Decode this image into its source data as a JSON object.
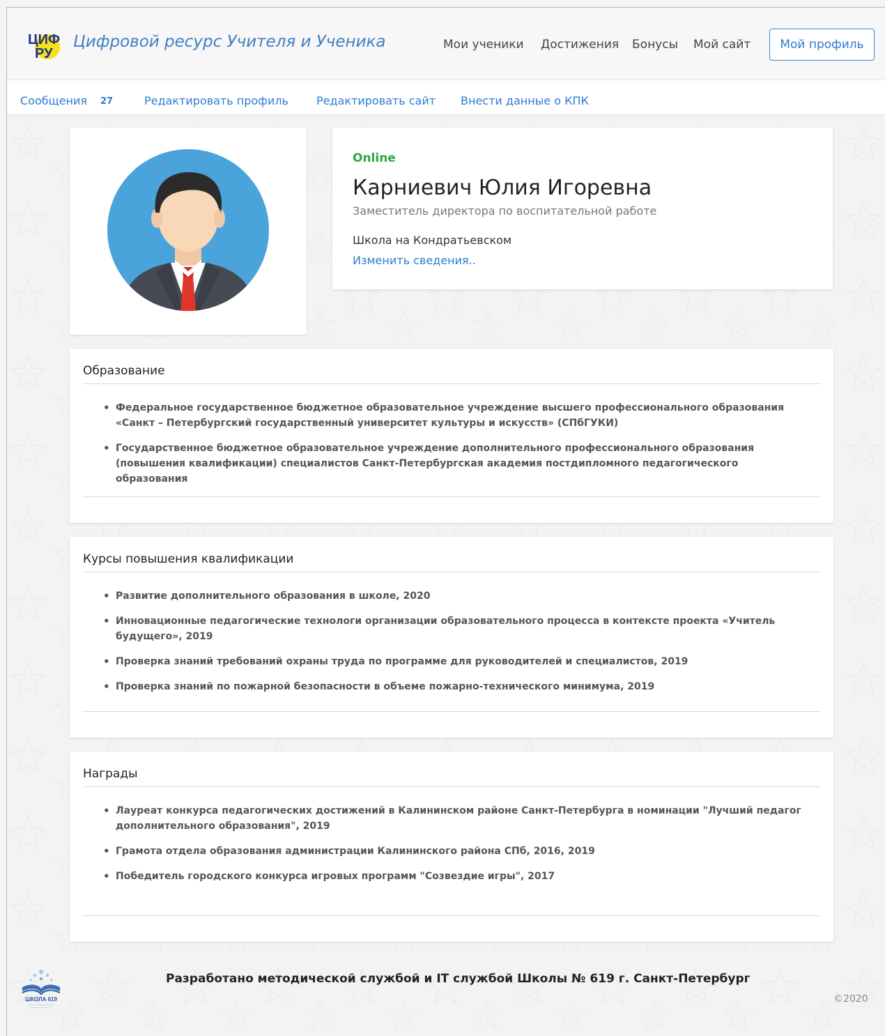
{
  "header": {
    "brand_logo_text": "ЦИФ РУ",
    "brand_name": "Цифровой ресурс Учителя и Ученика",
    "nav": [
      "Мои ученики",
      "Достижения",
      "Бонусы",
      "Мой сайт"
    ],
    "profile_button": "Мой профиль"
  },
  "subnav": {
    "messages_label": "Сообщения",
    "messages_count": "27",
    "edit_profile": "Редактировать профиль",
    "edit_site": "Редактировать сайт",
    "add_kpk": "Внести данные о КПК"
  },
  "profile": {
    "status": "Online",
    "name": "Карниевич Юлия Игоревна",
    "position": "Заместитель директора по воспитательной работе",
    "school": "Школа на Кондратьевском",
    "edit_link": "Изменить сведения.."
  },
  "education": {
    "title": "Образование",
    "items": [
      "Федеральное государственное бюджетное образовательное учреждение высшего профессионального образования «Санкт – Петербургский государственный университет культуры и искусств» (СПбГУКИ)",
      "Государственное бюджетное образовательное учреждение дополнительного профессионального образования (повышения квалификации) специалистов Санкт-Петербургская академия постдипломного педагогического образования"
    ]
  },
  "courses": {
    "title": "Курсы повышения квалификации",
    "items": [
      "Развитие дополнительного образования в школе, 2020",
      "Инновационные педагогические технологи организации образовательного процесса в контексте проекта «Учитель будущего», 2019",
      "Проверка знаний требований охраны труда по программе для руководителей и специалистов, 2019",
      "Проверка знаний по пожарной безопасности в объеме пожарно-технического минимума, 2019"
    ]
  },
  "awards": {
    "title": "Награды",
    "items": [
      "Лауреат конкурса педагогических достижений в Калининском районе Санкт-Петербурга в номинации \"Лучший педагог дополнительного образования\", 2019",
      "Грамота отдела образования администрации Калининского района СПб, 2016, 2019",
      "Победитель городского конкурса игровых программ \"Созвездие игры\", 2017"
    ]
  },
  "footer": {
    "logo_caption": "ШКОЛА 619",
    "text": "Разработано методической службой и IT службой Школы № 619 г. Санкт-Петербург",
    "copyright": "©2020"
  },
  "colors": {
    "accent": "#2f7bd0",
    "online": "#28a745",
    "logo_yellow": "#f3e319"
  },
  "icons": {
    "avatar": "user-avatar-icon",
    "brand": "cifru-logo-icon",
    "footer": "school-619-logo-icon"
  }
}
